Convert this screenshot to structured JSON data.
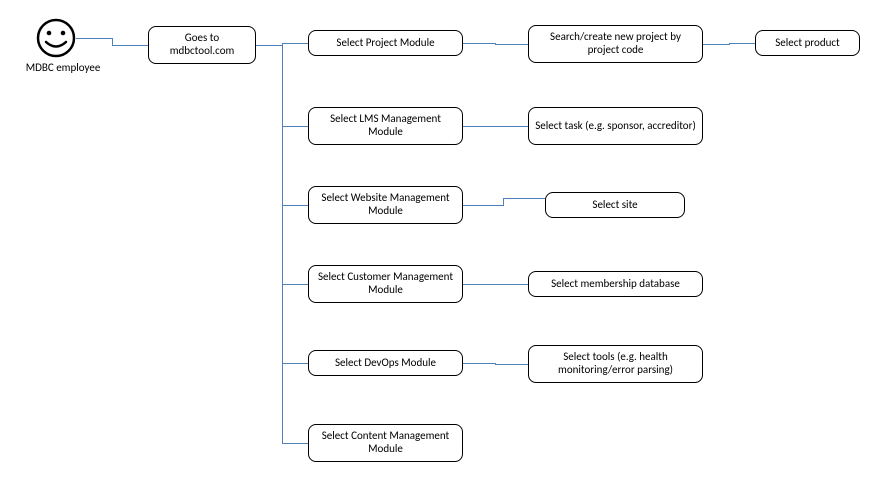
{
  "actor": {
    "label": "MDBC employee"
  },
  "start": {
    "label": "Goes to mdbctool.com"
  },
  "rows": [
    {
      "module": "Select Project Module",
      "next": "Search/create new project by project code",
      "final": "Select product"
    },
    {
      "module": "Select LMS Management Module",
      "next": "Select task (e.g. sponsor, accreditor)"
    },
    {
      "module": "Select Website Management Module",
      "next": "Select site"
    },
    {
      "module": "Select Customer Management Module",
      "next": "Select membership database"
    },
    {
      "module": "Select DevOps Module",
      "next": "Select tools (e.g. health monitoring/error parsing)"
    },
    {
      "module": "Select Content Management Module"
    }
  ]
}
